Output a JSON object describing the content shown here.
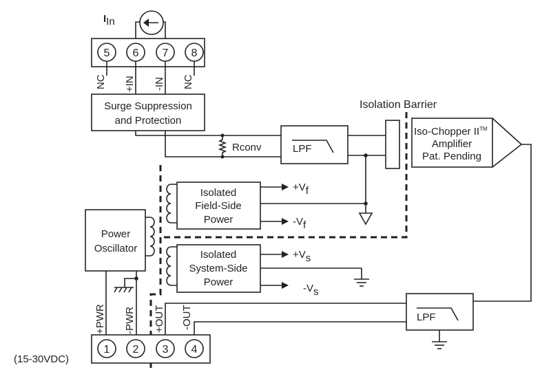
{
  "current_label": {
    "main": "I",
    "sub": "In"
  },
  "top_terminals": [
    {
      "number": "5",
      "label": "NC"
    },
    {
      "number": "6",
      "label": "+IN"
    },
    {
      "number": "7",
      "label": "-IN"
    },
    {
      "number": "8",
      "label": "NC"
    }
  ],
  "bottom_terminals": [
    {
      "number": "1",
      "label": "+PWR"
    },
    {
      "number": "2",
      "label": "-PWR"
    },
    {
      "number": "3",
      "label": "+OUT"
    },
    {
      "number": "4",
      "label": "-OUT"
    }
  ],
  "surge": {
    "line1": "Surge Suppression",
    "line2": "and Protection"
  },
  "rconv": "Rconv",
  "lpf": "LPF",
  "isolation_barrier": "Isolation Barrier",
  "amplifier": {
    "line1a": "Iso-Chopper II",
    "tm": "TM",
    "line2": "Amplifier",
    "line3": "Pat. Pending"
  },
  "field_power": {
    "line1": "Isolated",
    "line2": "Field-Side",
    "line3": "Power",
    "pos": "+V",
    "neg": "-V",
    "sub": "f"
  },
  "system_power": {
    "line1": "Isolated",
    "line2": "System-Side",
    "line3": "Power",
    "pos": "+V",
    "neg": "-V",
    "sub": "s"
  },
  "oscillator": {
    "line1": "Power",
    "line2": "Oscillator"
  },
  "supply_range": "(15-30VDC)"
}
